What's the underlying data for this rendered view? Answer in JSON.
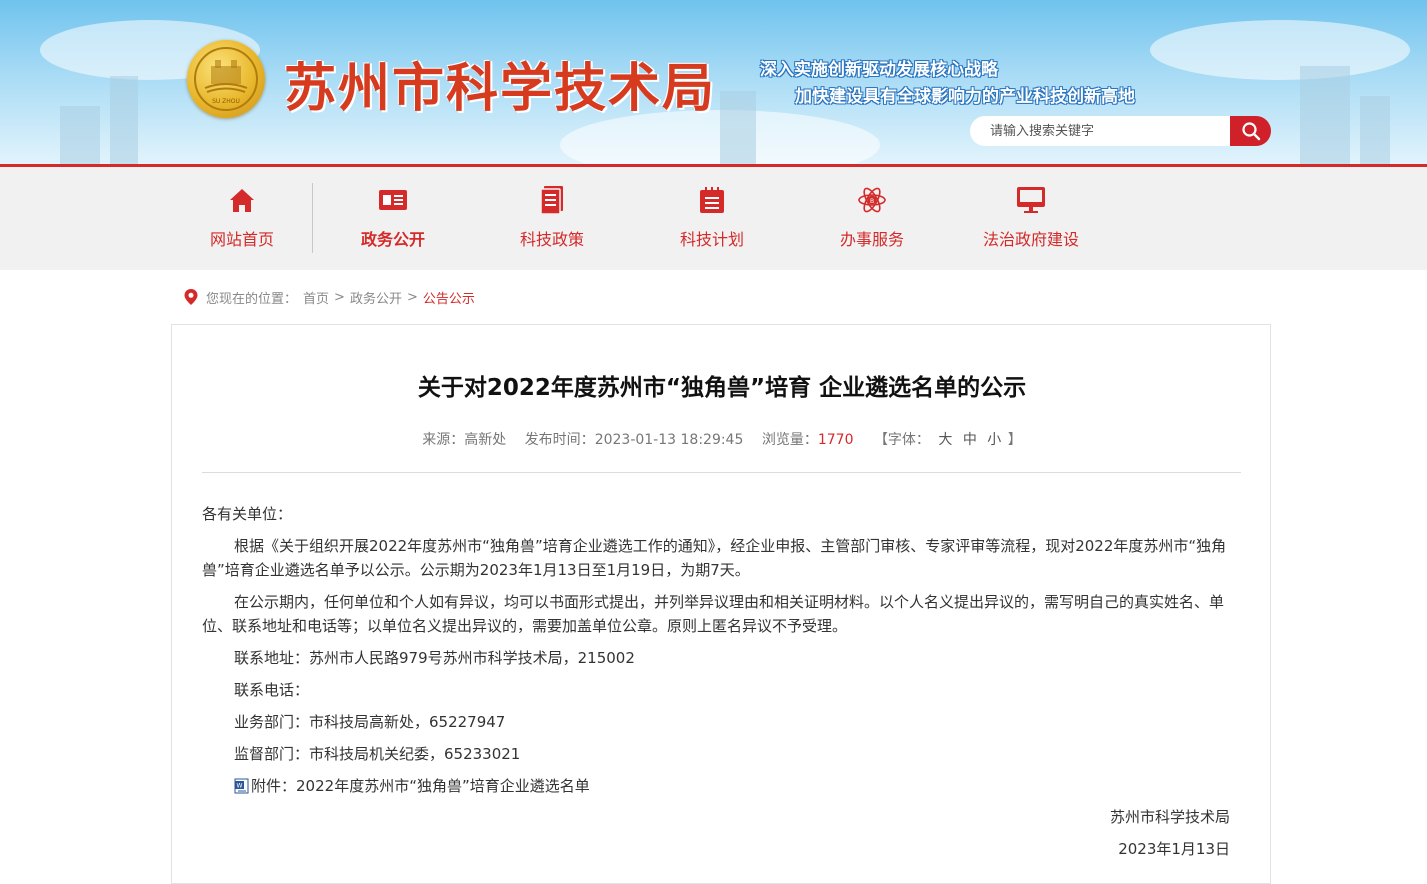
{
  "header": {
    "site_title": "苏州市科学技术局",
    "slogan_line1": "深入实施创新驱动发展核心战略",
    "slogan_line2": "加快建设具有全球影响力的产业科技创新高地",
    "search_placeholder": "请输入搜索关键字",
    "emblem_text": "SU ZHOU"
  },
  "nav": {
    "items": [
      {
        "label": "网站首页",
        "icon": "home-icon"
      },
      {
        "label": "政务公开",
        "icon": "id-card-icon",
        "active": true
      },
      {
        "label": "科技政策",
        "icon": "document-icon"
      },
      {
        "label": "科技计划",
        "icon": "calendar-icon"
      },
      {
        "label": "办事服务",
        "icon": "atom-icon"
      },
      {
        "label": "法治政府建设",
        "icon": "monitor-icon"
      }
    ]
  },
  "breadcrumb": {
    "prefix": "您现在的位置：",
    "items": [
      "首页",
      "政务公开",
      "公告公示"
    ],
    "separator": ">"
  },
  "article": {
    "title": "关于对2022年度苏州市“独角兽”培育 企业遴选名单的公示",
    "meta": {
      "source_label": "来源：",
      "source": "高新处",
      "time_label": "发布时间：",
      "time": "2023-01-13 18:29:45",
      "views_label": "浏览量：",
      "views": "1770",
      "font_label": "【字体：",
      "font_large": "大",
      "font_medium": "中",
      "font_small": "小",
      "font_close": "】"
    },
    "salutation": "各有关单位：",
    "paragraph1": "根据《关于组织开展2022年度苏州市“独角兽”培育企业遴选工作的通知》，经企业申报、主管部门审核、专家评审等流程，现对2022年度苏州市“独角兽”培育企业遴选名单予以公示。公示期为2023年1月13日至1月19日，为期7天。",
    "paragraph2": "在公示期内，任何单位和个人如有异议，均可以书面形式提出，并列举异议理由和相关证明材料。以个人名义提出异议的，需写明自己的真实姓名、单位、联系地址和电话等；以单位名义提出异议的，需要加盖单位公章。原则上匿名异议不予受理。",
    "contact_address": "联系地址：苏州市人民路979号苏州市科学技术局，215002",
    "contact_phone": "联系电话：",
    "business_dept": "业务部门：市科技局高新处，65227947",
    "supervise_dept": "监督部门：市科技局机关纪委，65233021",
    "attachment_label": "附件：",
    "attachment_name": "2022年度苏州市“独角兽”培育企业遴选名单",
    "sign_org": "苏州市科学技术局",
    "sign_date": "2023年1月13日"
  },
  "colors": {
    "brand_red": "#d42a2a",
    "header_sky": "#6fc3ee",
    "nav_bg": "#f1f1f1"
  }
}
